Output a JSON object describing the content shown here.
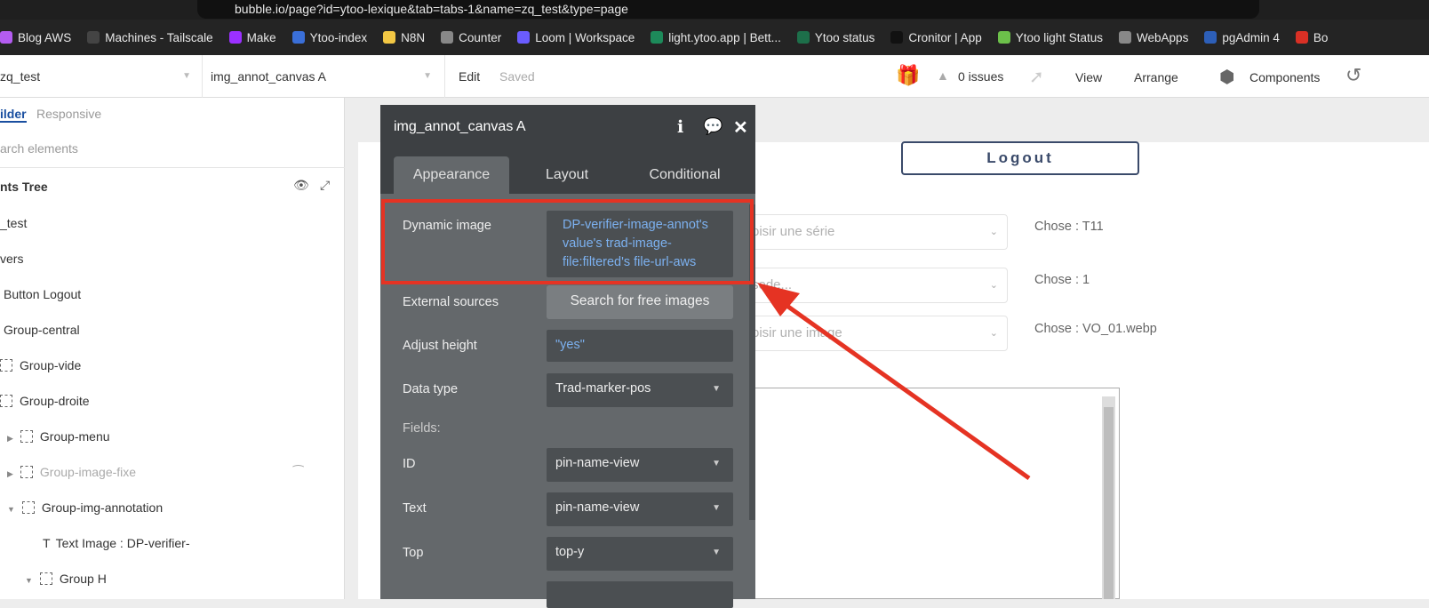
{
  "browser": {
    "url": "bubble.io/page?id=ytoo-lexique&tab=tabs-1&name=zq_test&type=page",
    "bookmarks": [
      {
        "label": "Blog AWS",
        "color": "#b35cf0"
      },
      {
        "label": "Machines - Tailscale",
        "color": "#444"
      },
      {
        "label": "Make",
        "color": "#9b30ff"
      },
      {
        "label": "Ytoo-index",
        "color": "#3a6fd8"
      },
      {
        "label": "N8N",
        "color": "#f2c744"
      },
      {
        "label": "Counter",
        "color": "#888"
      },
      {
        "label": "Loom | Workspace",
        "color": "#6a5cff"
      },
      {
        "label": "light.ytoo.app | Bett...",
        "color": "#1d8a5a"
      },
      {
        "label": "Ytoo status",
        "color": "#1d6f4a"
      },
      {
        "label": "Cronitor | App",
        "color": "#111"
      },
      {
        "label": "Ytoo light Status",
        "color": "#6cc04a"
      },
      {
        "label": "WebApps",
        "color": "#888"
      },
      {
        "label": "pgAdmin 4",
        "color": "#2d5fb8"
      },
      {
        "label": "Bo",
        "color": "#d93025"
      }
    ]
  },
  "header": {
    "page": "zq_test",
    "element": "img_annot_canvas A",
    "edit": "Edit",
    "saved": "Saved",
    "issues": "0 issues",
    "view": "View",
    "arrange": "Arrange",
    "components": "Components"
  },
  "left": {
    "tabs": [
      "ilder",
      "Responsive"
    ],
    "search_placeholder": "arch elements",
    "tree_title": "nts Tree",
    "items": [
      "_test",
      "vers",
      "Button Logout",
      "Group-central",
      "Group-vide",
      "Group-droite",
      "Group-menu",
      "Group-image-fixe",
      "Group-img-annotation",
      "Text Image : DP-verifier-",
      "Group H"
    ]
  },
  "canvas": {
    "logout": "Logout",
    "dropdowns": [
      "oisir une série",
      "sode...",
      "oisir une image"
    ],
    "chose": [
      "Chose :   T11",
      "Chose :   1",
      "Chose : VO_01.webp"
    ]
  },
  "panel": {
    "title": "img_annot_canvas A",
    "tabs": [
      "Appearance",
      "Layout",
      "Conditional"
    ],
    "dynamic_image_label": "Dynamic image",
    "dynamic_image_value": "DP-verifier-image-annot's value's trad-image-file:filtered's file-url-aws",
    "external_label": "External sources",
    "external_button": "Search for free images",
    "adjust_label": "Adjust height",
    "adjust_value": "\"yes\"",
    "datatype_label": "Data type",
    "datatype_value": "Trad-marker-pos",
    "fields_label": "Fields:",
    "fields": [
      {
        "label": "ID",
        "value": "pin-name-view"
      },
      {
        "label": "Text",
        "value": "pin-name-view"
      },
      {
        "label": "Top",
        "value": "top-y"
      }
    ]
  },
  "annotation_color": "#e53323"
}
